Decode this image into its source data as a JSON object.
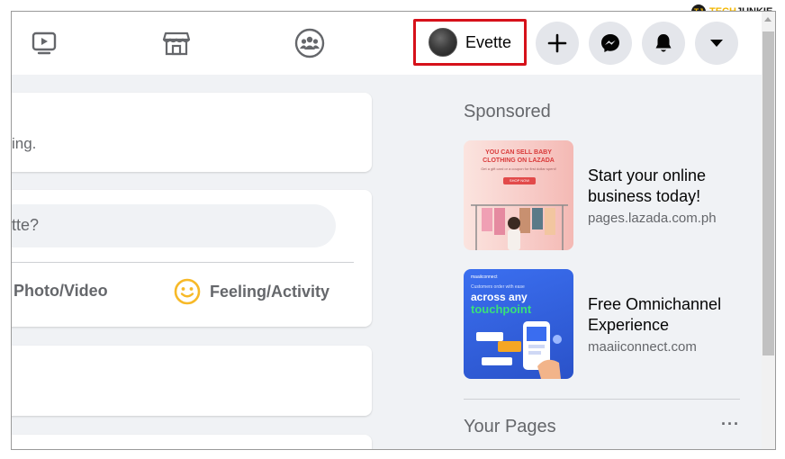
{
  "watermark": {
    "brand_a": "TECH",
    "brand_b": "JUNKIE",
    "logo_letters": "TJ"
  },
  "topbar": {
    "nav_icons": [
      "watch-icon",
      "marketplace-icon",
      "groups-icon"
    ],
    "profile": {
      "name": "Evette"
    },
    "actions": [
      "create-icon",
      "messenger-icon",
      "notifications-icon",
      "account-menu-icon"
    ]
  },
  "feed": {
    "card1_text": "ing.",
    "composer_placeholder": "tte?",
    "photo_video_label": "Photo/Video",
    "feeling_label": "Feeling/Activity"
  },
  "sidebar": {
    "sponsored_title": "Sponsored",
    "ads": [
      {
        "title": "Start your online business today!",
        "domain": "pages.lazada.com.ph",
        "image_headline": "YOU CAN SELL BABY CLOTHING ON LAZADA",
        "image_sub": "Get a gift card or a coupon for first dollar spent!",
        "image_button": "SHOP NOW"
      },
      {
        "title": "Free Omnichannel Experience",
        "domain": "maaiiconnect.com",
        "image_brand": "maaiiconnect",
        "image_sub": "Customers order with ease",
        "image_line1": "across any",
        "image_line2": "touchpoint"
      }
    ],
    "your_pages_title": "Your Pages",
    "more_label": "···"
  },
  "colors": {
    "accent_red": "#d6111a",
    "bg": "#f0f2f5",
    "ad1_bg": "#f7cbc7",
    "ad2_bg": "#2a5bd7",
    "highlight_green": "#39e07a"
  }
}
